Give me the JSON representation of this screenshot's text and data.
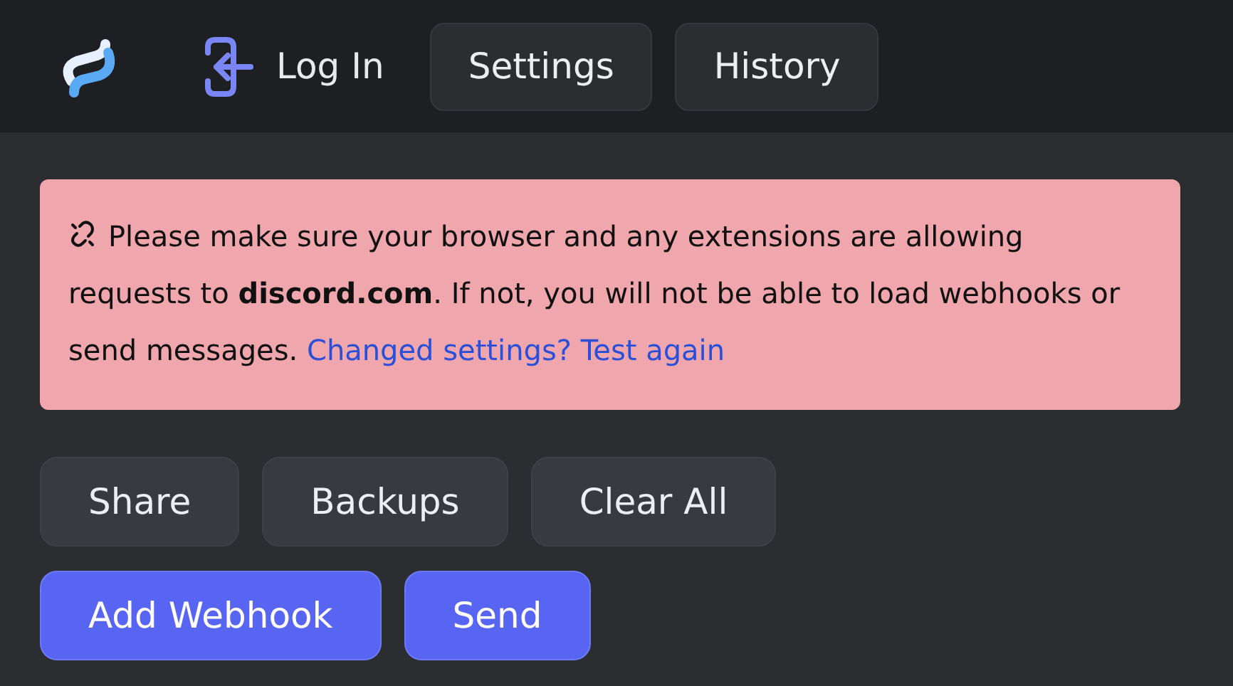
{
  "header": {
    "login": "Log In",
    "nav": [
      {
        "label": "Settings"
      },
      {
        "label": "History"
      }
    ]
  },
  "alert": {
    "text": "Please make sure your browser and any extensions are allowing requests to **discord.com**. If not, you will not be able to load webhooks or send messages.",
    "link": "Changed settings? Test again"
  },
  "button_rows": [
    [
      {
        "label": "Share",
        "kind": "secondary"
      },
      {
        "label": "Backups",
        "kind": "secondary"
      },
      {
        "label": "Clear All",
        "kind": "secondary"
      }
    ],
    [
      {
        "label": "Add Webhook",
        "kind": "primary"
      },
      {
        "label": "Send",
        "kind": "primary"
      }
    ]
  ]
}
